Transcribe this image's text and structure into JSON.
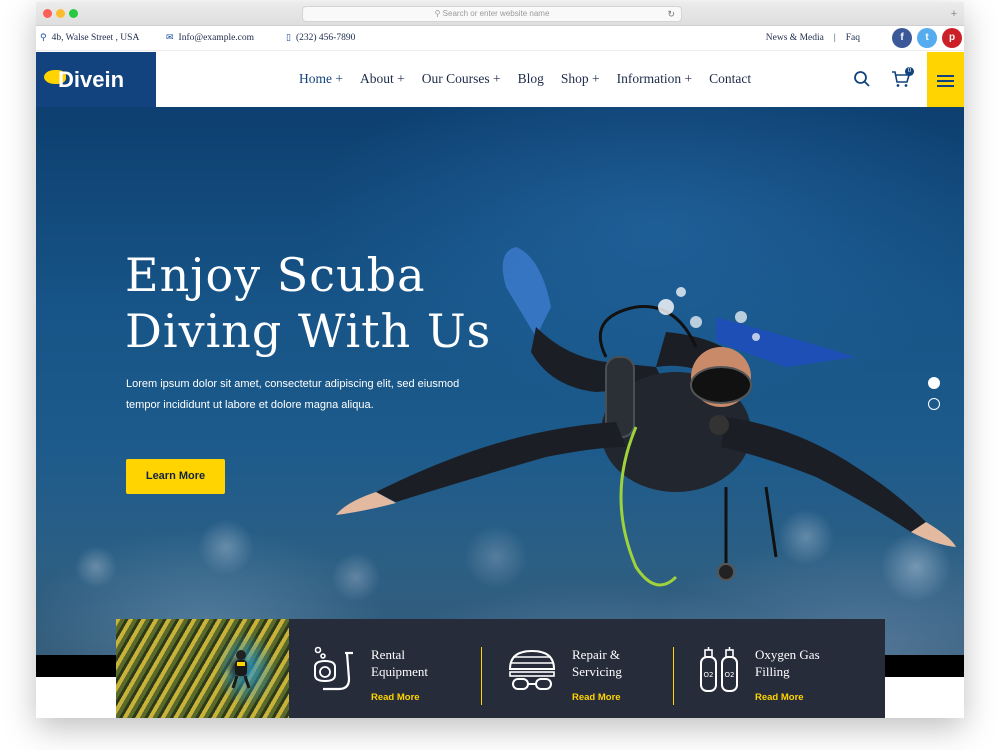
{
  "browser": {
    "address_placeholder": "Search or enter website name",
    "reload_icon": "reload-icon",
    "new_tab_icon": "plus-icon"
  },
  "topbar": {
    "address": "4b, Walse Street , USA",
    "email": "Info@example.com",
    "phone": "(232) 456-7890",
    "links": [
      "News & Media",
      "Faq"
    ],
    "separator": "|",
    "social": [
      {
        "name": "facebook",
        "glyph": "f",
        "color": "#3b5998"
      },
      {
        "name": "twitter",
        "glyph": "t",
        "color": "#55acee"
      },
      {
        "name": "pinterest",
        "glyph": "p",
        "color": "#cb2027"
      }
    ]
  },
  "nav": {
    "logo_text": "Divein",
    "items": [
      {
        "label": "Home +",
        "active": true
      },
      {
        "label": "About +"
      },
      {
        "label": "Our Courses +"
      },
      {
        "label": "Blog"
      },
      {
        "label": "Shop +"
      },
      {
        "label": "Information +"
      },
      {
        "label": "Contact"
      }
    ],
    "cart_count": "0"
  },
  "hero": {
    "title_line1": "Enjoy Scuba",
    "title_line2": "Diving With Us",
    "subtitle_line1": "Lorem ipsum dolor sit amet, consectetur adipiscing elit, sed eiusmod",
    "subtitle_line2": "tempor incididunt ut labore et dolore magna aliqua.",
    "button": "Learn More",
    "slider_active": 1,
    "slider_count": 2
  },
  "services": [
    {
      "title_line1": "Rental",
      "title_line2": "Equipment",
      "link": "Read More",
      "icon": "snorkel-icon"
    },
    {
      "title_line1": "Repair &",
      "title_line2": "Servicing",
      "link": "Read More",
      "icon": "diving-mask-icon"
    },
    {
      "title_line1": "Oxygen Gas",
      "title_line2": "Filling",
      "link": "Read More",
      "icon": "oxygen-tank-icon"
    }
  ],
  "colors": {
    "brand_blue": "#12437f",
    "accent_yellow": "#ffd400",
    "panel_dark": "#272c3a"
  }
}
